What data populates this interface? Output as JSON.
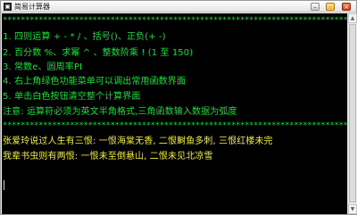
{
  "window": {
    "title": "简易计算器",
    "app_icon_glyph": "▣",
    "controls": {
      "minimize": "–",
      "maximize": "□",
      "close": "×"
    }
  },
  "console": {
    "separator_top": "******************************************************************************",
    "menu": [
      "1. 四则运算 + - * / 、括号()、正负(+ -)",
      "2. 百分数 %、求幂 ^ 、整数阶乘 ! (1 至 150)",
      "3. 常数e、圆周率PI",
      "4. 右上角绿色功能菜单可以调出常用函数界面",
      "5. 单击白色按钮清空整个计算界面"
    ],
    "note": "注意: 运算符必须为英文半角格式,三角函数输入数据为弧度",
    "separator_bottom": "******************************************************************************",
    "poem": [
      "张爱玲说过人生有三恨: 一恨海棠无香, 二恨鲥鱼多刺, 三恨红楼未完",
      "我辈书虫则有两恨: 一恨未至倒悬山, 二恨未见北凉雪"
    ]
  },
  "colors": {
    "console_bg": "#000000",
    "text_green": "#13e13a",
    "text_yellow": "#f2ee38"
  },
  "icons": {
    "scroll_up": "arrow-up-icon",
    "scroll_down": "arrow-down-icon"
  }
}
